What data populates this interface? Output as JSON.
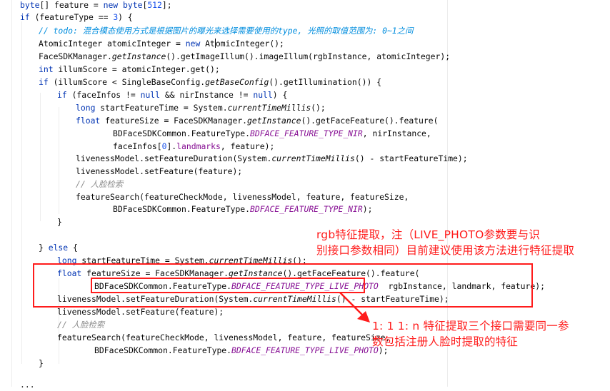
{
  "code_lines": [
    "<span class=\"t-kw\">byte</span>[] feature = <span class=\"t-kw\">new byte</span>[<span class=\"t-num\">512</span>];",
    "<span class=\"t-kw\">if</span> (featureType == <span class=\"t-num\">3</span>) {",
    "<span class=\"t-todo\">// todo: 混合模态使用方式是根据图片的曝光来选择需要使用的type, 光照的取值范围为: 0~1之间</span>",
    "AtomicInteger atomicInteger = <span class=\"t-kw\">new</span> At<span class=\"caret\"></span>omicInteger();",
    "FaceSDKManager.<span class=\"t-it\">getInstance</span>().getImageIllum().imageIllum(rgbInstance, atomicInteger);",
    "<span class=\"t-kw\">int</span> illumScore = atomicInteger.get();",
    "<span class=\"t-kw\">if</span> (illumScore &lt; SingleBaseConfig.<span class=\"t-it\">getBaseConfig</span>().getIllumination()) {",
    "<span class=\"t-kw\">if</span> (faceInfos != <span class=\"t-kw\">null</span> &amp;&amp; nirInstance != <span class=\"t-kw\">null</span>) {",
    "<span class=\"t-kw\">long</span> startFeatureTime = System.<span class=\"t-it\">currentTimeMillis</span>();",
    "<span class=\"t-kw\">float</span> featureSize = FaceSDKManager.<span class=\"t-it\">getInstance</span>().getFaceFeature().feature(",
    "BDFaceSDKCommon.FeatureType.<span class=\"t-const\">BDFACE_FEATURE_TYPE_NIR</span>, nirInstance,",
    "faceInfos[<span class=\"t-num\">0</span>].<span class=\"t-field\">landmarks</span>, feature);",
    "livenessModel.setFeatureDuration(System.<span class=\"t-it\">currentTimeMillis</span>() - startFeatureTime);",
    "livenessModel.setFeature(feature);",
    "<span class=\"t-cm\">// 人脸检索</span>",
    "featureSearch(featureCheckMode, livenessModel, feature, featureSize,",
    "BDFaceSDKCommon.FeatureType.<span class=\"t-const\">BDFACE_FEATURE_TYPE_NIR</span>);",
    "}",
    "",
    "} <span class=\"t-kw\">else</span> {",
    "<span class=\"t-kw\">long</span> startFeatureTime = System.<span class=\"t-it\">currentTimeMillis</span>();",
    "<span class=\"t-kw\">float</span> featureSize = FaceSDKManager.<span class=\"t-it\">getInstance</span>().getFaceFeature().feature(",
    "BDFaceSDKCommon.FeatureType.<span class=\"t-const\">BDFACE_FEATURE_TYPE_LIVE_PHOTO</span>  rgbInstance, landmark, feature);",
    "livenessModel.setFeatureDuration(System.<span class=\"t-it\">currentTimeMillis</span>() - startFeatureTime);",
    "livenessModel.setFeature(feature);",
    "<span class=\"t-cm\">// 人脸检索</span>",
    "featureSearch(featureCheckMode, livenessModel, feature, featureSize,",
    "BDFaceSDKCommon.FeatureType.<span class=\"t-const\">BDFACE_FEATURE_TYPE_LIVE_PHOTO</span>);",
    "}",
    "",
    "..."
  ],
  "annotations": {
    "note_top": "rgb特征提取，注（LIVE_PHOTO参数要与识\n别接口参数相同）目前建议使用该方法进行特征提取",
    "note_bottom": "1: 1  1: n  特征提取三个接口需要同一参\n数包括注册人脸时提取的特征",
    "color": "#ff1c1c"
  }
}
